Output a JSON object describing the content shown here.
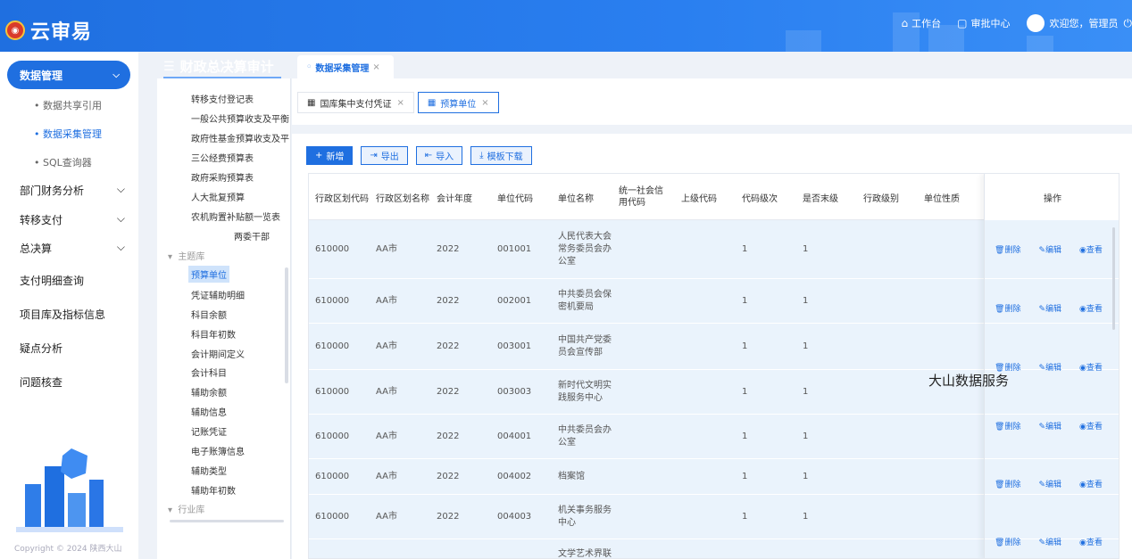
{
  "app": {
    "name": "云审易"
  },
  "topbar": {
    "workspace": "工作台",
    "approval": "审批中心",
    "welcome": "欢迎您，管理员"
  },
  "sidebar": {
    "active_menu": "数据管理",
    "subitems": [
      "数据共享引用",
      "数据采集管理",
      "SQL查询器"
    ],
    "menus": [
      "部门财务分析",
      "转移支付",
      "总决算",
      "支付明细查询",
      "项目库及指标信息",
      "疑点分析",
      "问题核查"
    ],
    "copyright": "Copyright © 2024 陕西大山"
  },
  "panel": {
    "title": "财政总决算审计",
    "top_tab": "数据采集管理"
  },
  "tree": {
    "items_a": [
      "转移支付登记表",
      "一般公共预算收支及平衡",
      "政府性基金预算收支及平",
      "三公经费预算表",
      "政府采购预算表",
      "人大批复预算",
      "农机购置补贴额一览表",
      "两委干部"
    ],
    "group_main": "主题库",
    "items_b": [
      "预算单位",
      "凭证辅助明细",
      "科目余额",
      "科目年初数",
      "会计期间定义",
      "会计科目",
      "辅助余额",
      "辅助信息",
      "记账凭证",
      "电子账簿信息",
      "辅助类型",
      "辅助年初数"
    ],
    "group_industry": "行业库"
  },
  "subtabs": [
    "国库集中支付凭证",
    "预算单位"
  ],
  "toolbar": {
    "add": "新增",
    "export": "导出",
    "import": "导入",
    "template": "模板下载"
  },
  "table": {
    "headers": [
      "行政区划代码",
      "行政区划名称",
      "会计年度",
      "单位代码",
      "单位名称",
      "统一社会信用代码",
      "上级代码",
      "代码级次",
      "是否末级",
      "行政级别",
      "单位性质"
    ],
    "op_header": "操作",
    "rows": [
      [
        "610000",
        "AA市",
        "2022",
        "001001",
        "人民代表大会常务委员会办公室",
        "",
        "",
        "1",
        "1",
        "",
        ""
      ],
      [
        "610000",
        "AA市",
        "2022",
        "002001",
        "中共委员会保密机要局",
        "",
        "",
        "1",
        "1",
        "",
        ""
      ],
      [
        "610000",
        "AA市",
        "2022",
        "003001",
        "中国共产党委员会宣传部",
        "",
        "",
        "1",
        "1",
        "",
        ""
      ],
      [
        "610000",
        "AA市",
        "2022",
        "003003",
        "新时代文明实践服务中心",
        "",
        "",
        "1",
        "1",
        "",
        ""
      ],
      [
        "610000",
        "AA市",
        "2022",
        "004001",
        "中共委员会办公室",
        "",
        "",
        "1",
        "1",
        "",
        ""
      ],
      [
        "610000",
        "AA市",
        "2022",
        "004002",
        "档案馆",
        "",
        "",
        "1",
        "1",
        "",
        ""
      ],
      [
        "610000",
        "AA市",
        "2022",
        "004003",
        "机关事务服务中心",
        "",
        "",
        "1",
        "1",
        "",
        ""
      ],
      [
        "",
        "",
        "",
        "",
        "文学艺术界联",
        "",
        "",
        "",
        "",
        "",
        ""
      ]
    ],
    "ops": {
      "delete": "删除",
      "edit": "编辑",
      "view": "查看"
    }
  },
  "watermark": "大山数据服务",
  "colors": {
    "primary": "#1f6fe0",
    "row_bg": "#eaf3fc"
  }
}
